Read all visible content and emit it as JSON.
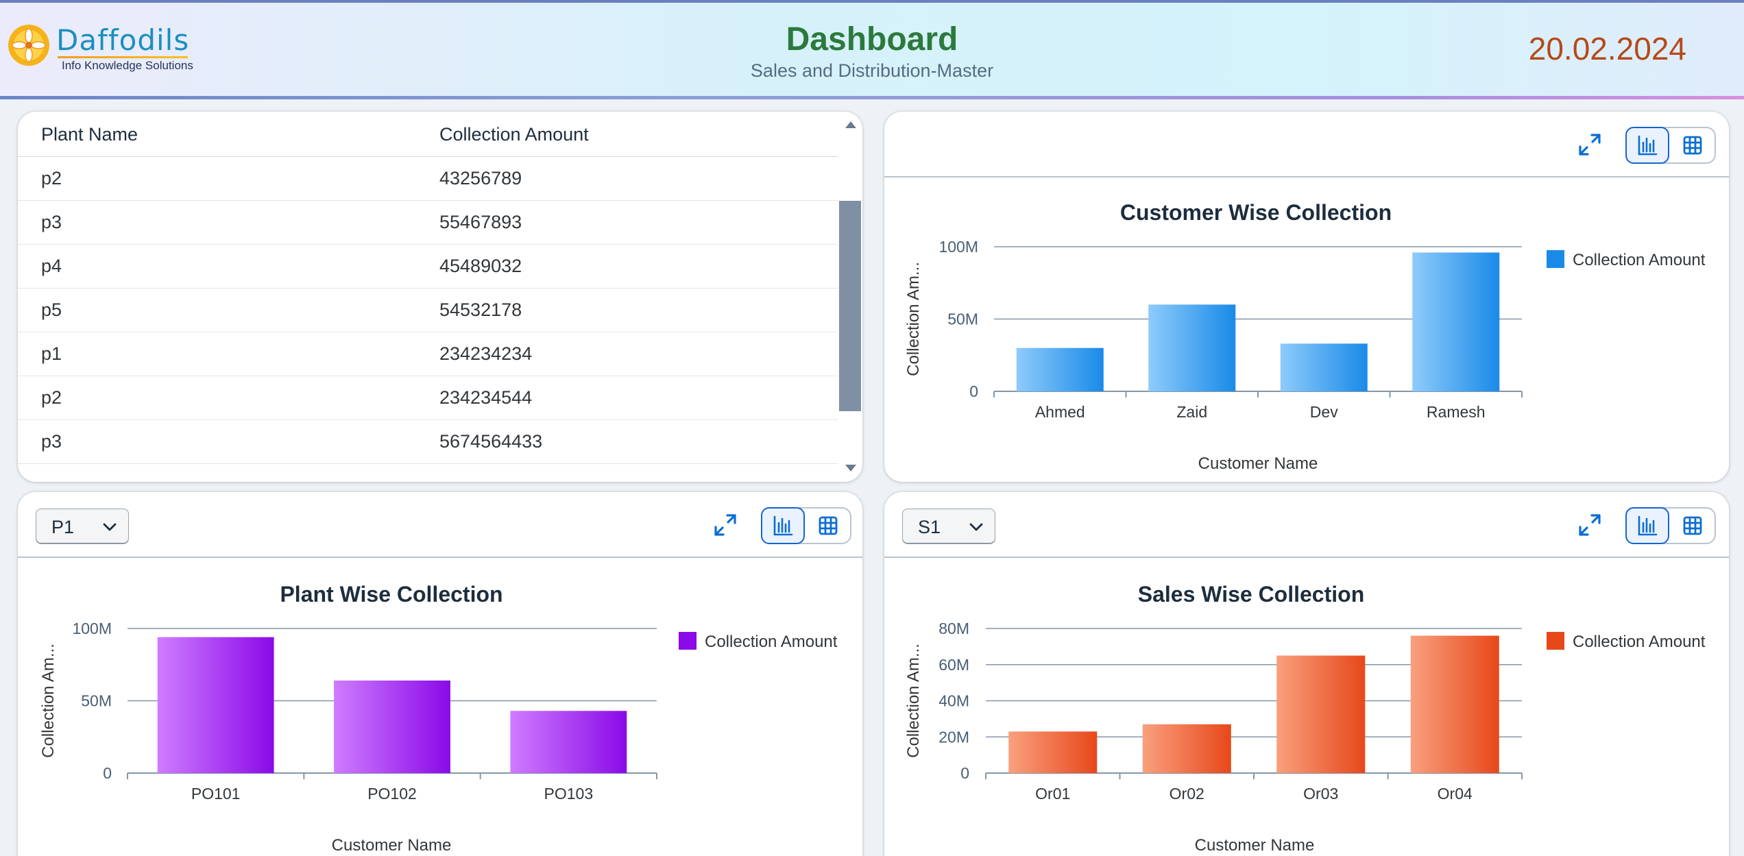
{
  "header": {
    "logo_name": "Daffodils",
    "logo_tagline": "Info Knowledge Solutions",
    "title": "Dashboard",
    "subtitle": "Sales and Distribution-Master",
    "date": "20.02.2024"
  },
  "table": {
    "columns": [
      "Plant Name",
      "Collection Amount"
    ],
    "rows": [
      [
        "p2",
        "43256789"
      ],
      [
        "p3",
        "55467893"
      ],
      [
        "p4",
        "45489032"
      ],
      [
        "p5",
        "54532178"
      ],
      [
        "p1",
        "234234234"
      ],
      [
        "p2",
        "234234544"
      ],
      [
        "p3",
        "5674564433"
      ]
    ]
  },
  "controls": {
    "plant_select_value": "P1",
    "sales_select_value": "S1"
  },
  "icons": {
    "fullscreen": "fullscreen-icon",
    "chart_view": "bar-chart-icon",
    "table_view": "grid-table-icon",
    "dropdown": "chevron-down-icon"
  },
  "chart_data": [
    {
      "id": "customer",
      "type": "bar",
      "title": "Customer Wise Collection",
      "xlabel": "Customer Name",
      "ylabel": "Collection Am...",
      "categories": [
        "Ahmed",
        "Zaid",
        "Dev",
        "Ramesh"
      ],
      "series": [
        {
          "name": "Collection Amount",
          "values": [
            30000000,
            60000000,
            33000000,
            96000000
          ]
        }
      ],
      "ylim": [
        0,
        100000000
      ],
      "yticks": [
        "0",
        "50M",
        "100M"
      ],
      "color_light": "#8ecbfb",
      "color_dark": "#1a8ae8",
      "legend": "top-right",
      "grid": true
    },
    {
      "id": "plant",
      "type": "bar",
      "title": "Plant Wise Collection",
      "xlabel": "Customer Name",
      "ylabel": "Collection Am...",
      "categories": [
        "PO101",
        "PO102",
        "PO103"
      ],
      "series": [
        {
          "name": "Collection Amount",
          "values": [
            94000000,
            64000000,
            43000000
          ]
        }
      ],
      "ylim": [
        0,
        100000000
      ],
      "yticks": [
        "0",
        "50M",
        "100M"
      ],
      "color_light": "#cf7cff",
      "color_dark": "#8a0ae8",
      "legend": "top-right",
      "grid": true
    },
    {
      "id": "sales",
      "type": "bar",
      "title": "Sales Wise Collection",
      "xlabel": "Customer Name",
      "ylabel": "Collection Am...",
      "categories": [
        "Or01",
        "Or02",
        "Or03",
        "Or04"
      ],
      "series": [
        {
          "name": "Collection Amount",
          "values": [
            23000000,
            27000000,
            65000000,
            76000000
          ]
        }
      ],
      "ylim": [
        0,
        80000000
      ],
      "yticks": [
        "0",
        "20M",
        "40M",
        "60M",
        "80M"
      ],
      "color_light": "#f9a07e",
      "color_dark": "#e7481a",
      "legend": "top-right",
      "grid": true
    }
  ]
}
